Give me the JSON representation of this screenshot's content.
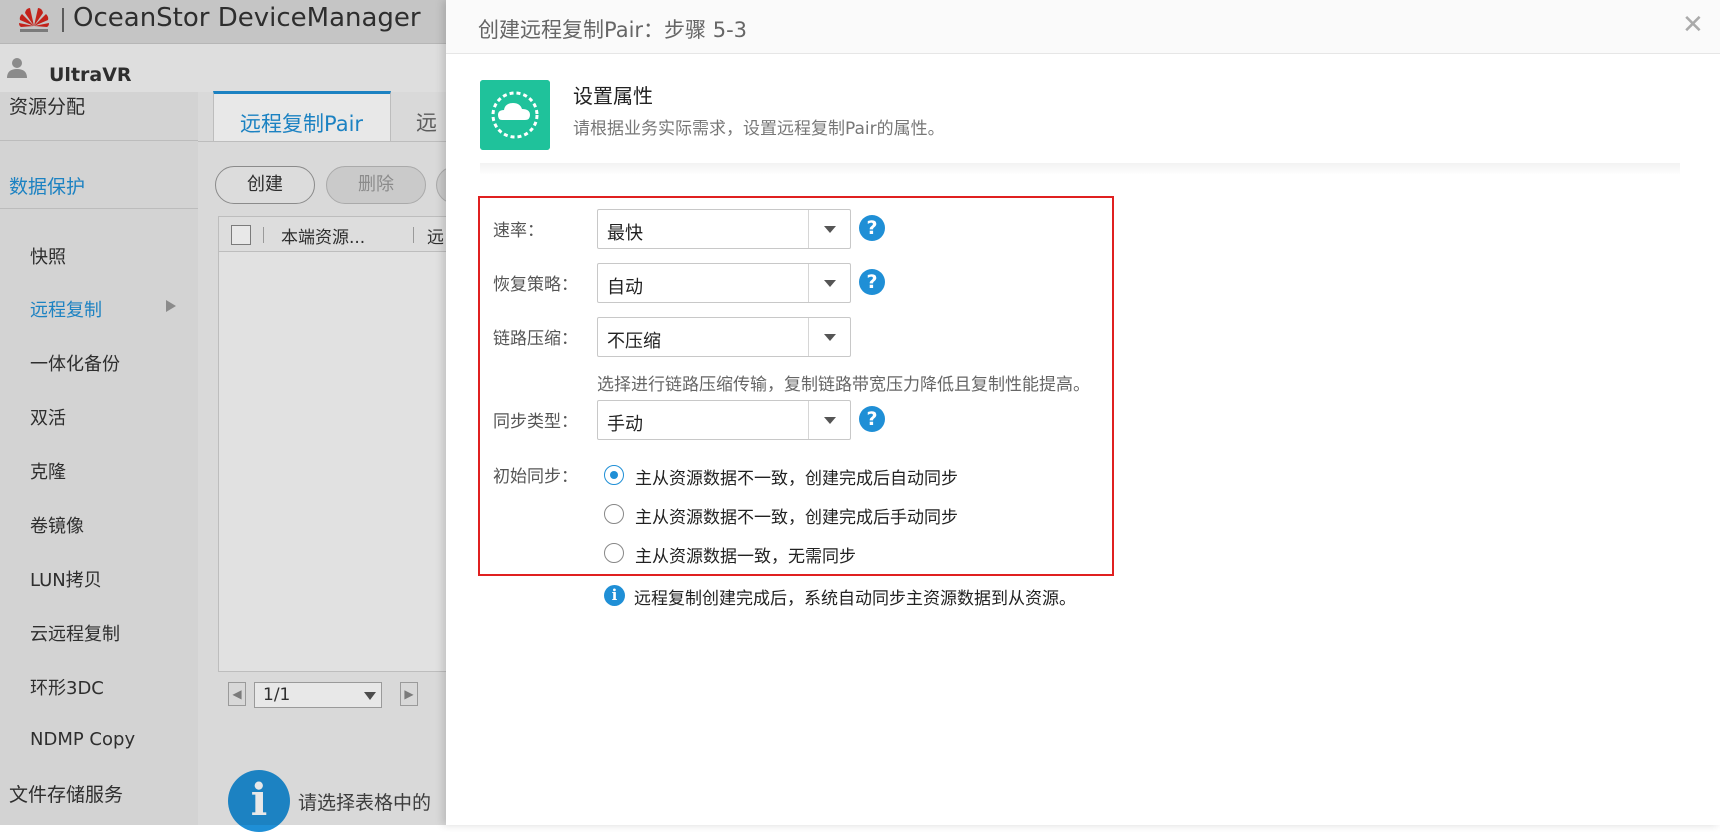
{
  "app": {
    "title": "OceanStor DeviceManager",
    "user": "UltraVR",
    "brand_color": "#1f8fd6"
  },
  "sidebar": {
    "items": [
      {
        "label": "资源分配",
        "icon": "none"
      },
      {
        "label": "数据保护",
        "active": true
      },
      {
        "label": "快照"
      },
      {
        "label": "远程复制",
        "active": true,
        "has_submenu": true
      },
      {
        "label": "一体化备份"
      },
      {
        "label": "双活"
      },
      {
        "label": "克隆"
      },
      {
        "label": "卷镜像"
      },
      {
        "label": "LUN拷贝"
      },
      {
        "label": "云远程复制"
      },
      {
        "label": "环形3DC"
      },
      {
        "label": "NDMP Copy"
      },
      {
        "label": "文件存储服务"
      }
    ]
  },
  "main": {
    "tabs": [
      {
        "label": "远程复制Pair",
        "active": true
      },
      {
        "label": "远"
      }
    ],
    "toolbar": {
      "create_label": "创建",
      "delete_label": "删除"
    },
    "table": {
      "columns": [
        "本端资源...",
        "远"
      ]
    },
    "pager": {
      "page": "1/1"
    },
    "hint": "请选择表格中的"
  },
  "dialog": {
    "title": "创建远程复制Pair：步骤 5-3",
    "close_icon": "close-icon",
    "step_icon": "sync-cloud-icon",
    "step_icon_color": "#1fc29b",
    "step_title": "设置属性",
    "step_desc": "请根据业务实际需求，设置远程复制Pair的属性。",
    "highlight_color": "#e02020",
    "fields": {
      "rate": {
        "label": "速率：",
        "value": "最快"
      },
      "recovery": {
        "label": "恢复策略：",
        "value": "自动"
      },
      "compression": {
        "label": "链路压缩：",
        "value": "不压缩",
        "note": "选择进行链路压缩传输，复制链路带宽压力降低且复制性能提高。"
      },
      "sync_type": {
        "label": "同步类型：",
        "value": "手动"
      },
      "initial_sync": {
        "label": "初始同步：",
        "options": [
          "主从资源数据不一致，创建完成后自动同步",
          "主从资源数据不一致，创建完成后手动同步",
          "主从资源数据一致，无需同步"
        ],
        "selected_index": 0
      }
    },
    "info": "远程复制创建完成后，系统自动同步主资源数据到从资源。"
  }
}
